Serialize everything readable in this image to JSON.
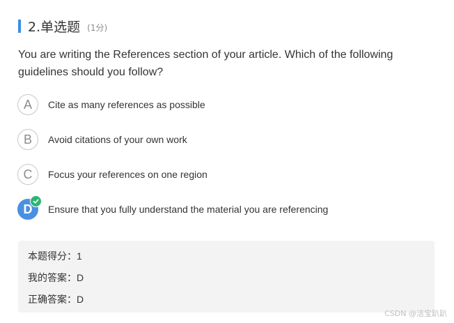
{
  "question": {
    "title": "2.单选题",
    "points": "(1分)",
    "text": "You are writing the References section of your article. Which of the following guidelines should you follow?"
  },
  "options": [
    {
      "letter": "A",
      "text": "Cite as many references as possible",
      "selected": false
    },
    {
      "letter": "B",
      "text": "Avoid citations of your own work",
      "selected": false
    },
    {
      "letter": "C",
      "text": "Focus your references on one region",
      "selected": false
    },
    {
      "letter": "D",
      "text": "Ensure that you fully understand the material you are referencing",
      "selected": true
    }
  ],
  "result": {
    "score_label": "本题得分：",
    "score_value": "1",
    "my_answer_label": "我的答案：",
    "my_answer_value": "D",
    "correct_answer_label": "正确答案：",
    "correct_answer_value": "D"
  },
  "watermark": "CSDN @洁宝趴趴",
  "colors": {
    "accent": "#3a8ee6",
    "selected": "#4a90e2",
    "correct": "#2bb673",
    "result_bg": "#f3f3f3"
  },
  "icons": {
    "check": "check-icon"
  }
}
